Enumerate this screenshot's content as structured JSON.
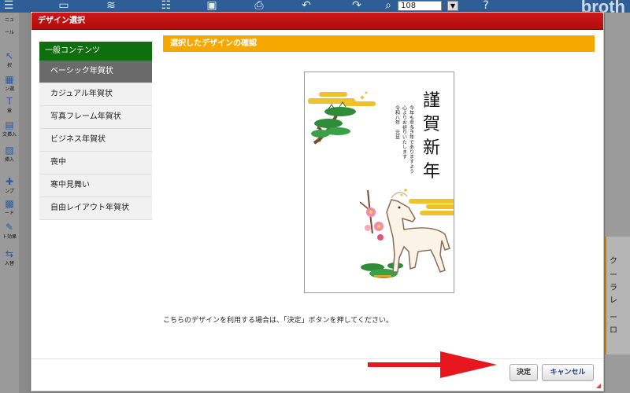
{
  "app": {
    "zoom_value": "108",
    "brand": "broth",
    "side_labels": [
      "ニュ",
      "ール",
      "択",
      "ン選",
      "章",
      "文挿入",
      "挿入",
      "ンプ",
      "ード",
      "ト効果",
      "入替"
    ],
    "right_labels": [
      "ク",
      "ー",
      "ラ",
      "レ",
      "ー",
      "ロ"
    ]
  },
  "dialog": {
    "title": "デザイン選択",
    "menu": {
      "header": "一般コンテンツ",
      "items": [
        {
          "label": "ベーシック年賀状",
          "active": true
        },
        {
          "label": "カジュアル年賀状"
        },
        {
          "label": "写真フレーム年賀状"
        },
        {
          "label": "ビジネス年賀状"
        },
        {
          "label": "喪中"
        },
        {
          "label": "寒中見舞い"
        },
        {
          "label": "自由レイアウト年賀状"
        }
      ]
    },
    "main_header": "選択したデザインの確認",
    "card": {
      "title_chars": [
        "謹",
        "賀",
        "新",
        "年"
      ],
      "message_lines": [
        "今年も幸多き年でありますよう",
        "心よりお祈りいたします",
        "令和八年　元旦"
      ]
    },
    "instruction": "こちらのデザインを利用する場合は、「決定」ボタンを押してください。",
    "buttons": {
      "ok": "決定",
      "cancel": "キャンセル"
    }
  },
  "colors": {
    "title_bar": "#c41212",
    "menu_header": "#0f6e0f",
    "main_header": "#f5a800",
    "arrow": "#e8171f"
  }
}
